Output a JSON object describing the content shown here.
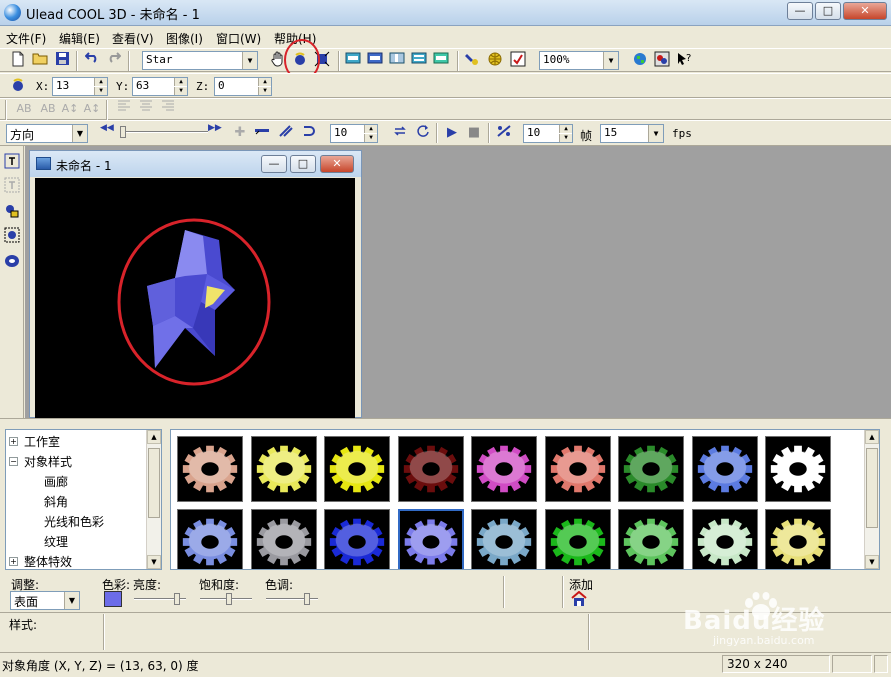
{
  "window": {
    "title": "Ulead COOL 3D - 未命名 - 1",
    "minimize": "—",
    "maximize": "□",
    "close": "✕"
  },
  "menu": [
    "文件(F)",
    "编辑(E)",
    "查看(V)",
    "图像(I)",
    "窗口(W)",
    "帮助(H)"
  ],
  "toolbar1": {
    "object_select": "Star",
    "zoom": "100%"
  },
  "toolbar2": {
    "x_label": "X:",
    "x_value": "13",
    "y_label": "Y:",
    "y_value": "63",
    "z_label": "Z:",
    "z_value": "0"
  },
  "toolbar3": {
    "buttons": [
      "AB",
      "AB",
      "A↕",
      "A↕"
    ]
  },
  "toolbar4": {
    "direction": "方向",
    "frame_count": "10",
    "frame_step": "10",
    "frame_label": "帧",
    "fps_value": "15",
    "fps_label": "fps"
  },
  "child_window": {
    "title": "未命名 - 1",
    "minimize": "—",
    "maximize": "□",
    "close": "✕"
  },
  "tree": {
    "items": [
      "工作室",
      "对象样式",
      "画廊",
      "斜角",
      "光线和色彩",
      "纹理",
      "整体特效"
    ]
  },
  "gallery": {
    "row1_colors": [
      "#d9a38d",
      "#e8e85a",
      "#e6e612",
      "#6b0d0d",
      "#d04cc4",
      "#e0786c",
      "#2a8a2a",
      "#5c7be0",
      "#ffffff"
    ],
    "row2_colors": [
      "#7a8ee0",
      "#9a9aa0",
      "#1a2ad6",
      "#7c7cea",
      "#7aa8c8",
      "#1bb81b",
      "#5ec45e",
      "#c8e8c8",
      "#e8e07a"
    ]
  },
  "attributes": {
    "adjust_label": "调整:",
    "adjust_value": "表面",
    "color_label": "色彩:",
    "brightness_label": "亮度:",
    "saturation_label": "饱和度:",
    "hue_label": "色调:",
    "add_label": "添加",
    "style_label": "样式:"
  },
  "status": {
    "text": "对象角度 (X, Y, Z) = (13, 63, 0) 度",
    "size": "320 x 240"
  },
  "watermark": {
    "text": "Baidu经验",
    "url": "jingyan.baidu.com"
  },
  "colors": {
    "annotation_red": "#d8232a",
    "star_blue": "#6c6ce8",
    "star_yellow": "#f0e46a"
  }
}
